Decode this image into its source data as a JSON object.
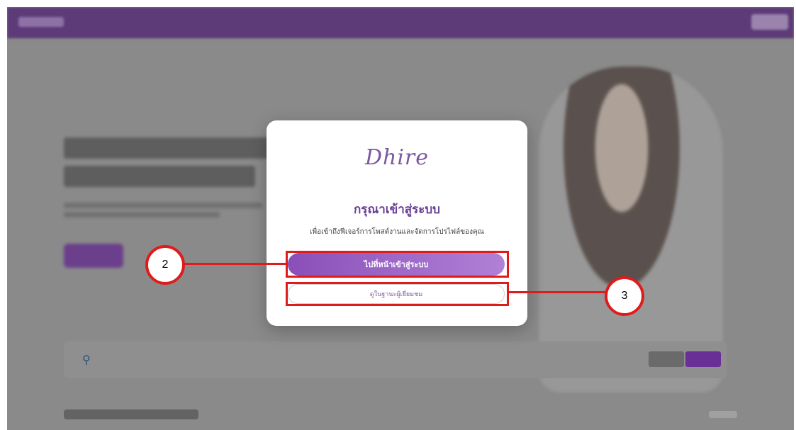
{
  "modal": {
    "logo_text": "Dhire",
    "title": "กรุณาเข้าสู่ระบบ",
    "subtitle": "เพื่อเข้าถึงฟีเจอร์การโพสต์งานและจัดการโปรไฟล์ของคุณ",
    "login_button_label": "ไปที่หน้าเข้าสู่ระบบ",
    "guest_button_label": "ดูในฐานะผู้เยี่ยมชม"
  },
  "annotations": {
    "callout_login": "2",
    "callout_guest": "3"
  },
  "colors": {
    "accent": "#7b57a0",
    "nav_bg": "#5d3a78",
    "highlight": "#e01b1b"
  },
  "icons": {
    "search": "search-icon"
  }
}
